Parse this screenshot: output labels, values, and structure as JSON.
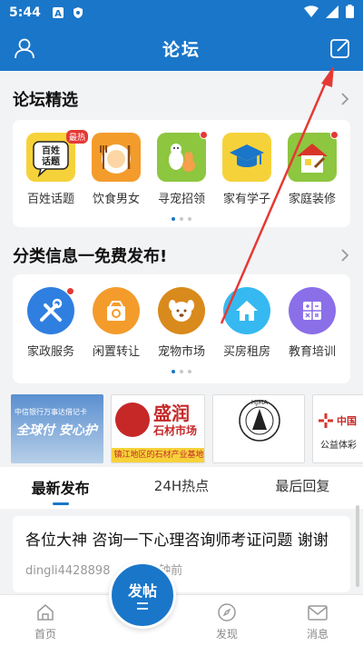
{
  "status_bar": {
    "time": "5:44"
  },
  "header": {
    "title": "论坛"
  },
  "featured": {
    "title": "论坛精选",
    "hot_badge": "最热",
    "items": [
      {
        "label": "百姓话题",
        "icon_text": "百姓\n话题"
      },
      {
        "label": "饮食男女"
      },
      {
        "label": "寻宠招领"
      },
      {
        "label": "家有学子"
      },
      {
        "label": "家庭装修"
      }
    ]
  },
  "classifieds": {
    "title": "分类信息一免费发布!",
    "items": [
      {
        "label": "家政服务"
      },
      {
        "label": "闲置转让"
      },
      {
        "label": "宠物市场"
      },
      {
        "label": "买房租房"
      },
      {
        "label": "教育培训"
      }
    ]
  },
  "banners": {
    "b1_line1": "中信银行万事达借记卡",
    "b1_line2": "全球付 安心护",
    "b2_title": "盛润",
    "b2_sub": "石材市场",
    "b2_bottom": "镇江地区的石材产业基地",
    "b3_center": "HJMA",
    "b4_line1": "中国",
    "b4_line2": "公益体彩"
  },
  "tabs": [
    {
      "label": "最新发布",
      "active": true
    },
    {
      "label": "24H热点",
      "active": false
    },
    {
      "label": "最后回复",
      "active": false
    }
  ],
  "post": {
    "title": "各位大神 咨询一下心理咨询师考证问题 谢谢",
    "author": "dingli4428898",
    "time": "14分钟前"
  },
  "bottom_nav": {
    "home": "首页",
    "post_button": "发帖",
    "discover": "发现",
    "messages": "消息"
  },
  "colors": {
    "primary": "#1a76c9",
    "annotation_arrow": "#e53935"
  }
}
